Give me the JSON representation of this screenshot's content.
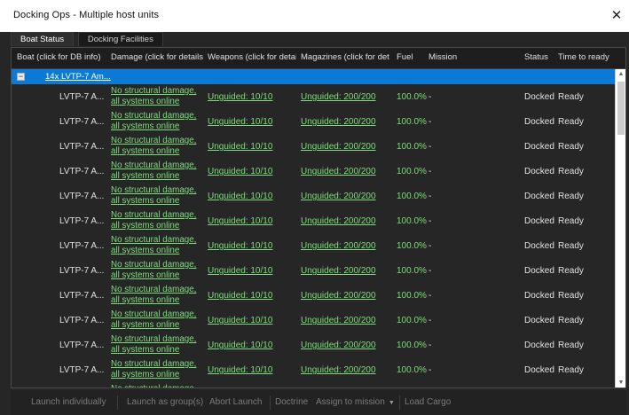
{
  "window": {
    "title": "Docking Ops - Multiple host units",
    "close_glyph": "✕"
  },
  "tabs": [
    {
      "label": "Boat Status",
      "active": true
    },
    {
      "label": "Docking Facilities",
      "active": false
    }
  ],
  "table": {
    "headers": {
      "boat": "Boat (click for DB info)",
      "damage": "Damage (click for details)",
      "weapons": "Weapons (click for details)",
      "magazines": "Magazines (click for details)",
      "fuel": "Fuel",
      "mission": "Mission",
      "status": "Status",
      "time_to_ready": "Time to ready"
    },
    "group": {
      "expander": "−",
      "label": "14x LVTP-7 Am..."
    },
    "rows": [
      {
        "boat": "LVTP-7 A...",
        "damage": "No structural damage, all systems online",
        "weapons": "Unguided: 10/10",
        "magazines": "Unguided: 200/200",
        "fuel": "100.0%",
        "mission": "-",
        "status": "Docked",
        "time_to_ready": "Ready"
      },
      {
        "boat": "LVTP-7 A...",
        "damage": "No structural damage, all systems online",
        "weapons": "Unguided: 10/10",
        "magazines": "Unguided: 200/200",
        "fuel": "100.0%",
        "mission": "-",
        "status": "Docked",
        "time_to_ready": "Ready"
      },
      {
        "boat": "LVTP-7 A...",
        "damage": "No structural damage, all systems online",
        "weapons": "Unguided: 10/10",
        "magazines": "Unguided: 200/200",
        "fuel": "100.0%",
        "mission": "-",
        "status": "Docked",
        "time_to_ready": "Ready"
      },
      {
        "boat": "LVTP-7 A...",
        "damage": "No structural damage, all systems online",
        "weapons": "Unguided: 10/10",
        "magazines": "Unguided: 200/200",
        "fuel": "100.0%",
        "mission": "-",
        "status": "Docked",
        "time_to_ready": "Ready"
      },
      {
        "boat": "LVTP-7 A...",
        "damage": "No structural damage, all systems online",
        "weapons": "Unguided: 10/10",
        "magazines": "Unguided: 200/200",
        "fuel": "100.0%",
        "mission": "-",
        "status": "Docked",
        "time_to_ready": "Ready"
      },
      {
        "boat": "LVTP-7 A...",
        "damage": "No structural damage, all systems online",
        "weapons": "Unguided: 10/10",
        "magazines": "Unguided: 200/200",
        "fuel": "100.0%",
        "mission": "-",
        "status": "Docked",
        "time_to_ready": "Ready"
      },
      {
        "boat": "LVTP-7 A...",
        "damage": "No structural damage, all systems online",
        "weapons": "Unguided: 10/10",
        "magazines": "Unguided: 200/200",
        "fuel": "100.0%",
        "mission": "-",
        "status": "Docked",
        "time_to_ready": "Ready"
      },
      {
        "boat": "LVTP-7 A...",
        "damage": "No structural damage, all systems online",
        "weapons": "Unguided: 10/10",
        "magazines": "Unguided: 200/200",
        "fuel": "100.0%",
        "mission": "-",
        "status": "Docked",
        "time_to_ready": "Ready"
      },
      {
        "boat": "LVTP-7 A...",
        "damage": "No structural damage, all systems online",
        "weapons": "Unguided: 10/10",
        "magazines": "Unguided: 200/200",
        "fuel": "100.0%",
        "mission": "-",
        "status": "Docked",
        "time_to_ready": "Ready"
      },
      {
        "boat": "LVTP-7 A...",
        "damage": "No structural damage, all systems online",
        "weapons": "Unguided: 10/10",
        "magazines": "Unguided: 200/200",
        "fuel": "100.0%",
        "mission": "-",
        "status": "Docked",
        "time_to_ready": "Ready"
      },
      {
        "boat": "LVTP-7 A...",
        "damage": "No structural damage, all systems online",
        "weapons": "Unguided: 10/10",
        "magazines": "Unguided: 200/200",
        "fuel": "100.0%",
        "mission": "-",
        "status": "Docked",
        "time_to_ready": "Ready"
      },
      {
        "boat": "LVTP-7 A...",
        "damage": "No structural damage, all systems online",
        "weapons": "Unguided: 10/10",
        "magazines": "Unguided: 200/200",
        "fuel": "100.0%",
        "mission": "-",
        "status": "Docked",
        "time_to_ready": "Ready"
      },
      {
        "boat": "",
        "damage": "No structural damage",
        "weapons": "",
        "magazines": "",
        "fuel": "",
        "mission": "",
        "status": "",
        "time_to_ready": ""
      }
    ]
  },
  "scrollbar": {
    "up_glyph": "▲",
    "down_glyph": "▼"
  },
  "toolbar": {
    "launch_individually": "Launch individually",
    "launch_as_group": "Launch as group(s)",
    "abort_launch": "Abort Launch",
    "doctrine": "Doctrine",
    "assign_to_mission": "Assign to mission",
    "assign_caret": "▼",
    "load_cargo": "Load Cargo"
  },
  "colors": {
    "selection": "#0a7ad6",
    "link_green": "#7ddd7a",
    "background": "#262626"
  }
}
